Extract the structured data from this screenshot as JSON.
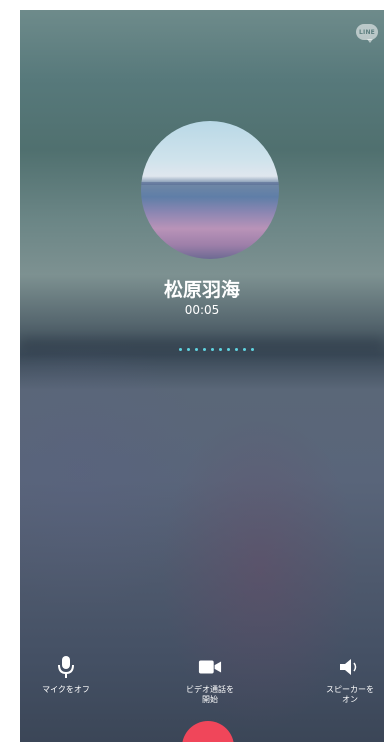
{
  "app": {
    "badge_text": "LINE"
  },
  "caller": {
    "name": "松原羽海",
    "duration": "00:05"
  },
  "controls": {
    "mute": {
      "label": "マイクをオフ",
      "icon": "microphone-icon"
    },
    "video": {
      "label": "ビデオ通話を\n開始",
      "icon": "video-camera-icon"
    },
    "speaker": {
      "label": "スピーカーを\nオン",
      "icon": "speaker-icon"
    },
    "end_call": {
      "icon": "end-call-icon",
      "color": "#f0465a"
    }
  },
  "colors": {
    "connecting_dots": "#5fd3e0",
    "end_call": "#f0465a"
  }
}
